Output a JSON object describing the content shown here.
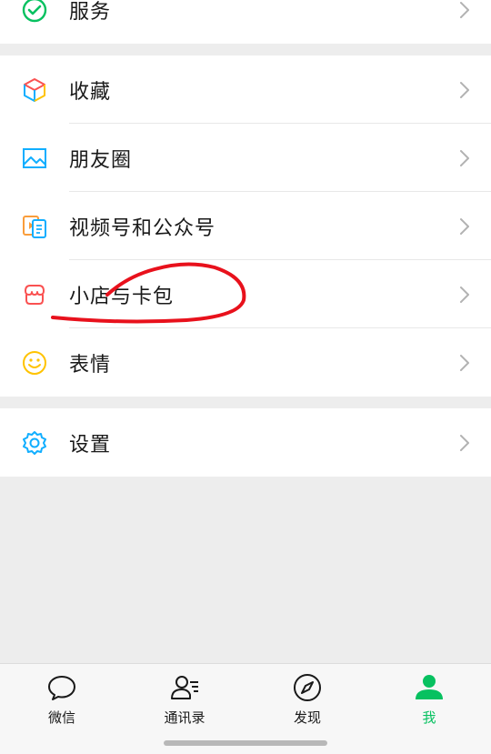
{
  "menu": {
    "group1": [
      {
        "label": "服务",
        "icon": "services-icon"
      }
    ],
    "group2": [
      {
        "label": "收藏",
        "icon": "favorites-cube-icon"
      },
      {
        "label": "朋友圈",
        "icon": "moments-picture-icon"
      },
      {
        "label": "视频号和公众号",
        "icon": "channels-video-icon"
      },
      {
        "label": "小店与卡包",
        "icon": "shop-card-icon"
      },
      {
        "label": "表情",
        "icon": "sticker-smile-icon"
      }
    ],
    "group3": [
      {
        "label": "设置",
        "icon": "settings-gear-icon"
      }
    ]
  },
  "tabbar": {
    "tabs": [
      {
        "label": "微信",
        "icon": "chat-bubble-icon"
      },
      {
        "label": "通讯录",
        "icon": "contacts-icon"
      },
      {
        "label": "发现",
        "icon": "compass-icon"
      },
      {
        "label": "我",
        "icon": "me-person-icon"
      }
    ],
    "active": "我"
  },
  "colors": {
    "accent": "#07c160",
    "background": "#ededed",
    "annotation": "#e8111c"
  }
}
